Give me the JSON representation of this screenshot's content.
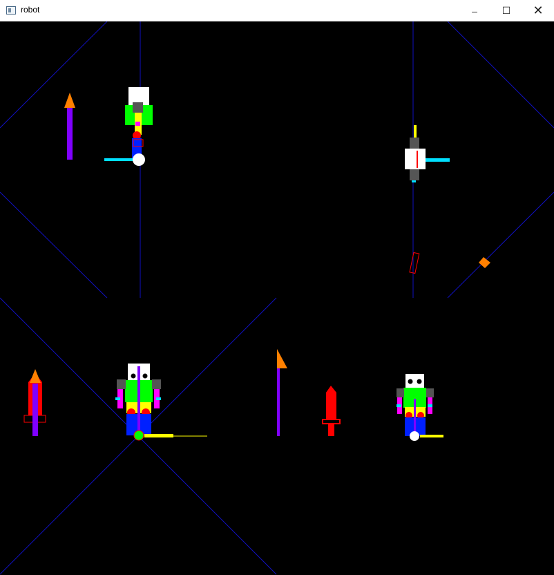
{
  "window": {
    "title": "robot",
    "controls": {
      "minimize": "–",
      "maximize": "☐",
      "close": "✕"
    }
  },
  "colors": {
    "background": "#000000",
    "grid": "#1010c0",
    "white": "#ffffff",
    "green": "#00ff00",
    "gray": "#555555",
    "blue": "#0020ff",
    "red": "#ff0000",
    "yellow": "#ffff00",
    "magenta": "#ff00ff",
    "cyan": "#00e0ff",
    "purple": "#8000ff",
    "orange": "#ff8000"
  }
}
